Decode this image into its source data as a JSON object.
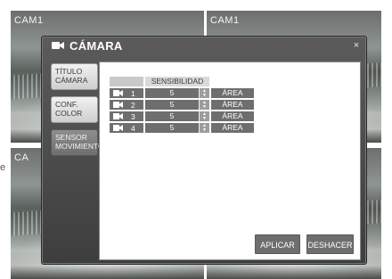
{
  "background": {
    "tiles": [
      {
        "label": "CAM1"
      },
      {
        "label": "CAM1"
      },
      {
        "label": "CA"
      },
      {
        "label": ""
      }
    ],
    "side_text": "e"
  },
  "dialog": {
    "title": "CÁMARA",
    "title_icon": "camera-icon",
    "close_label": "×"
  },
  "tabs": [
    {
      "label": "TÍTULO CÁMARA",
      "state": "active"
    },
    {
      "label": "CONF. COLOR",
      "state": "active"
    },
    {
      "label": "SENSOR MOVIMIENTO",
      "state": "inactive"
    }
  ],
  "table": {
    "header_sensitivity": "SENSIBILIDAD",
    "rows": [
      {
        "camera": "1",
        "sensitivity": "5",
        "area_label": "ÁREA"
      },
      {
        "camera": "2",
        "sensitivity": "5",
        "area_label": "ÁREA"
      },
      {
        "camera": "3",
        "sensitivity": "5",
        "area_label": "ÁREA"
      },
      {
        "camera": "4",
        "sensitivity": "5",
        "area_label": "ÁREA"
      }
    ]
  },
  "buttons": {
    "apply": "APLICAR",
    "undo": "DESHACER"
  },
  "colors": {
    "dialog_bg": "#4b4b4b",
    "panel_bg": "#ffffff",
    "cell_bg": "#6e6e6e",
    "tab_active": "#e0e0e0",
    "tab_inactive": "#7e7e7e"
  }
}
